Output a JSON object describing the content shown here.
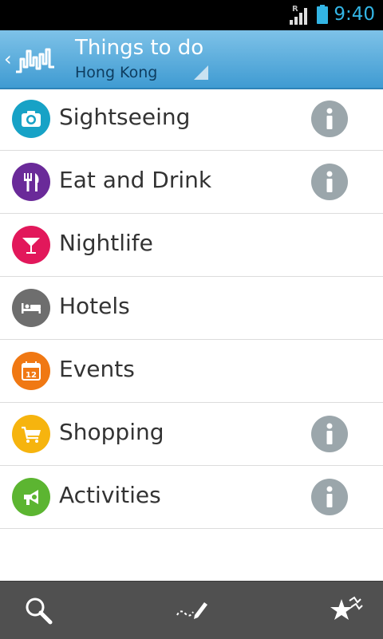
{
  "status_bar": {
    "time": "9:40",
    "roaming_indicator": "R"
  },
  "action_bar": {
    "title": "Things to do",
    "subtitle": "Hong Kong",
    "up_icon": "chevron-left-icon",
    "logo_icon": "city-skyline-icon"
  },
  "categories": [
    {
      "label": "Sightseeing",
      "icon": "camera-icon",
      "color": "#17a2c6",
      "has_info": true
    },
    {
      "label": "Eat and Drink",
      "icon": "fork-knife-icon",
      "color": "#6a2a99",
      "has_info": true
    },
    {
      "label": "Nightlife",
      "icon": "cocktail-icon",
      "color": "#e2185b",
      "has_info": false
    },
    {
      "label": "Hotels",
      "icon": "bed-icon",
      "color": "#6e6e6e",
      "has_info": false
    },
    {
      "label": "Events",
      "icon": "calendar-icon",
      "color": "#f07813",
      "has_info": false,
      "calendar_day": "12"
    },
    {
      "label": "Shopping",
      "icon": "shopping-cart-icon",
      "color": "#f6b40e",
      "has_info": true
    },
    {
      "label": "Activities",
      "icon": "megaphone-icon",
      "color": "#5cb531",
      "has_info": true
    }
  ],
  "bottom_bar": {
    "buttons": [
      {
        "icon": "search-icon"
      },
      {
        "icon": "route-pencil-icon"
      },
      {
        "icon": "favorite-stars-icon"
      }
    ]
  },
  "colors": {
    "action_bar_top": "#7ec2e8",
    "action_bar_bottom": "#3f9bd2",
    "clock": "#33b5e5",
    "info_button": "#9ba6ab",
    "bottom_bar": "#505050"
  }
}
